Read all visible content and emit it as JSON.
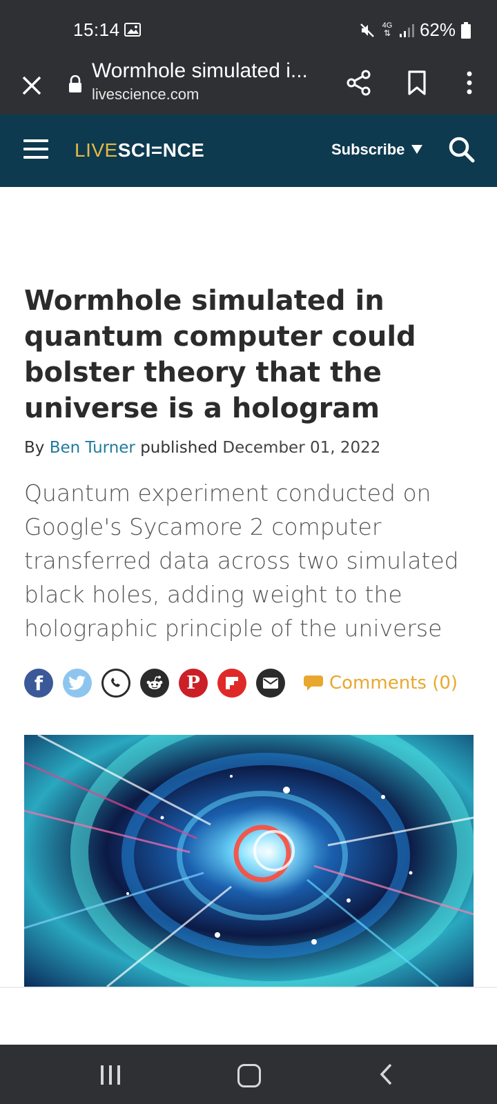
{
  "status": {
    "time": "15:14",
    "network": "4G",
    "battery": "62%",
    "icons": [
      "image-icon",
      "mute-icon",
      "data-icon",
      "signal-icon",
      "battery-icon"
    ]
  },
  "browser": {
    "title": "Wormhole simulated i...",
    "domain": "livescience.com",
    "icons": [
      "close-icon",
      "lock-icon",
      "share-icon",
      "bookmark-icon",
      "more-icon"
    ]
  },
  "site": {
    "logo_live": "LIVE",
    "logo_science": "SCI=NCE",
    "subscribe_label": "Subscribe",
    "colors": {
      "header_bg": "#0d3a4f",
      "logo_accent": "#e8b844"
    }
  },
  "article": {
    "headline": "Wormhole simulated in quantum computer could bolster theory that the universe is a hologram",
    "by_label": "By",
    "author": "Ben Turner",
    "published_label": "published",
    "date": "December 01, 2022",
    "standfirst": "Quantum experiment conducted on Google's Sycamore 2 computer transferred data across two simulated black holes, adding weight to the holographic principle of the universe",
    "comments_label": "Comments (0)",
    "share_buttons": [
      {
        "name": "facebook",
        "glyph": "f",
        "color": "#3b5998"
      },
      {
        "name": "twitter",
        "glyph": "",
        "color": "#8ec5ee"
      },
      {
        "name": "whatsapp",
        "glyph": "",
        "color": "#2b2b2b"
      },
      {
        "name": "reddit",
        "glyph": "",
        "color": "#2b2b2b"
      },
      {
        "name": "pinterest",
        "glyph": "P",
        "color": "#cb2027"
      },
      {
        "name": "flipboard",
        "glyph": "",
        "color": "#e12828"
      },
      {
        "name": "email",
        "glyph": "",
        "color": "#2b2b2b"
      }
    ]
  },
  "navbar": {
    "icons": [
      "recent-apps-icon",
      "home-icon",
      "back-icon"
    ]
  }
}
